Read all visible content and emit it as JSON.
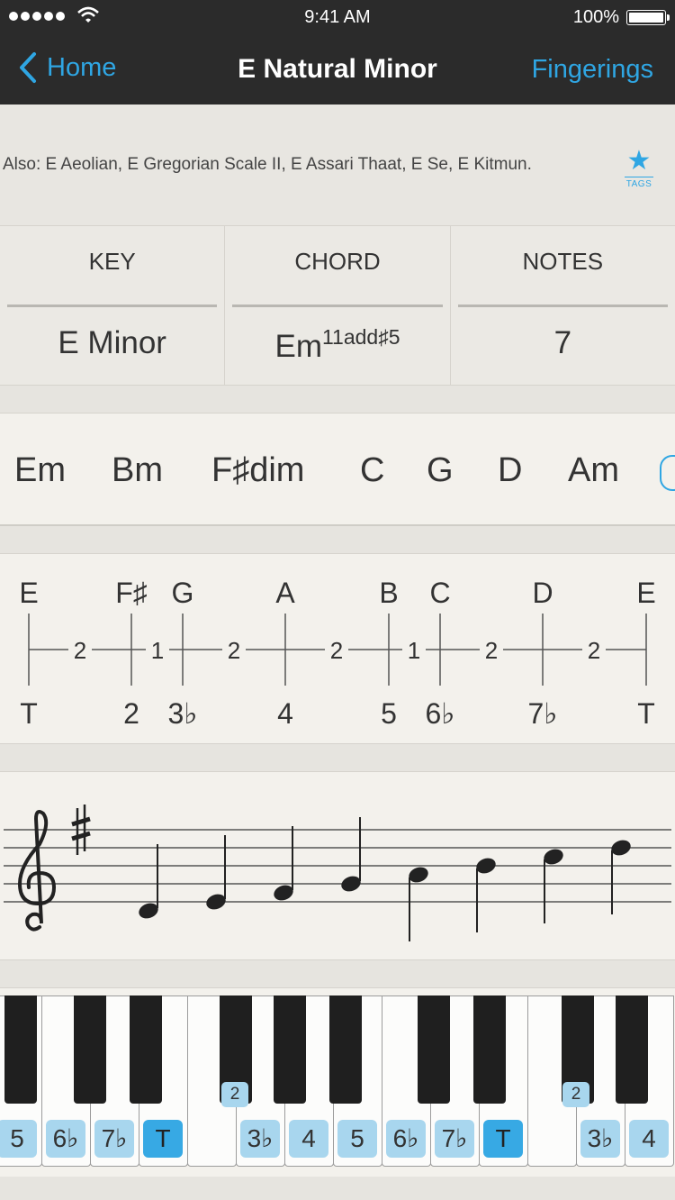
{
  "status_bar": {
    "time": "9:41 AM",
    "battery": "100%"
  },
  "nav": {
    "back_label": "Home",
    "title": "E Natural Minor",
    "right_label": "Fingerings"
  },
  "also": {
    "text": "Also: E Aeolian, E Gregorian Scale II, E Assari Thaat, E Se, E Kitmun.",
    "tags_label": "TAGS"
  },
  "info": {
    "key_header": "KEY",
    "chord_header": "CHORD",
    "notes_header": "NOTES",
    "key_value": "E Minor",
    "chord_base": "Em",
    "chord_ext": "11add♯5",
    "notes_value": "7"
  },
  "chords": [
    "Em",
    "Bm",
    "F♯dim",
    "C",
    "G",
    "D",
    "Am"
  ],
  "intervals": {
    "notes": [
      "E",
      "F♯",
      "G",
      "A",
      "B",
      "C",
      "D",
      "E"
    ],
    "steps": [
      "2",
      "1",
      "2",
      "2",
      "1",
      "2",
      "2"
    ],
    "degrees": [
      "T",
      "2",
      "3♭",
      "4",
      "5",
      "6♭",
      "7♭",
      "T"
    ]
  },
  "staff": {
    "key_signature": "F♯",
    "clef": "treble",
    "notes": [
      "E4",
      "F♯4",
      "G4",
      "A4",
      "B4",
      "C5",
      "D5",
      "E5"
    ]
  },
  "keyboard": {
    "labels": [
      "5",
      "6♭",
      "7♭",
      "T",
      "3♭",
      "4",
      "5",
      "6♭",
      "7♭",
      "T",
      "3♭",
      "4"
    ],
    "badges": [
      "2",
      "2"
    ],
    "accent": "#37a9e4",
    "label_color": "#a8d6ee"
  }
}
